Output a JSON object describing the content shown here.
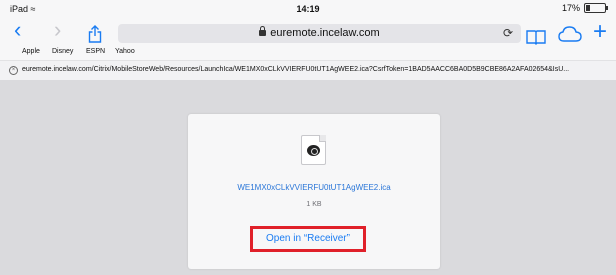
{
  "status_bar": {
    "device": "iPad",
    "time": "14:19",
    "battery": "17%"
  },
  "toolbar": {
    "back_icon": "chevron-left-icon",
    "forward_icon": "chevron-right-icon",
    "share_icon": "share-icon",
    "url": "euremote.incelaw.com",
    "reload_icon": "reload-icon",
    "bookmarks_icon": "bookmarks-book-icon",
    "icloud_icon": "cloud-icon",
    "new_tab_icon": "plus-icon"
  },
  "favorites": {
    "items": [
      "Apple",
      "Disney",
      "ESPN",
      "Yahoo"
    ]
  },
  "address_row": {
    "full_url": "euremote.incelaw.com/Citrix/MobileStoreWeb/Resources/LaunchIca/WE1MX0xCLkVVIERFU0tUT1AgWEE2.ica?CsrfToken=1BAD5AACC6BA0D5B9CBE86A2AFA02654&IsU..."
  },
  "download": {
    "file_name": "WE1MX0xCLkVVIERFU0tUT1AgWEE2.ica",
    "file_size": "1 KB",
    "open_in_label": "Open in “Receiver”"
  },
  "colors": {
    "accent": "#1a7cf2",
    "highlight_box": "#e0202a",
    "page_background": "#dadadd"
  }
}
